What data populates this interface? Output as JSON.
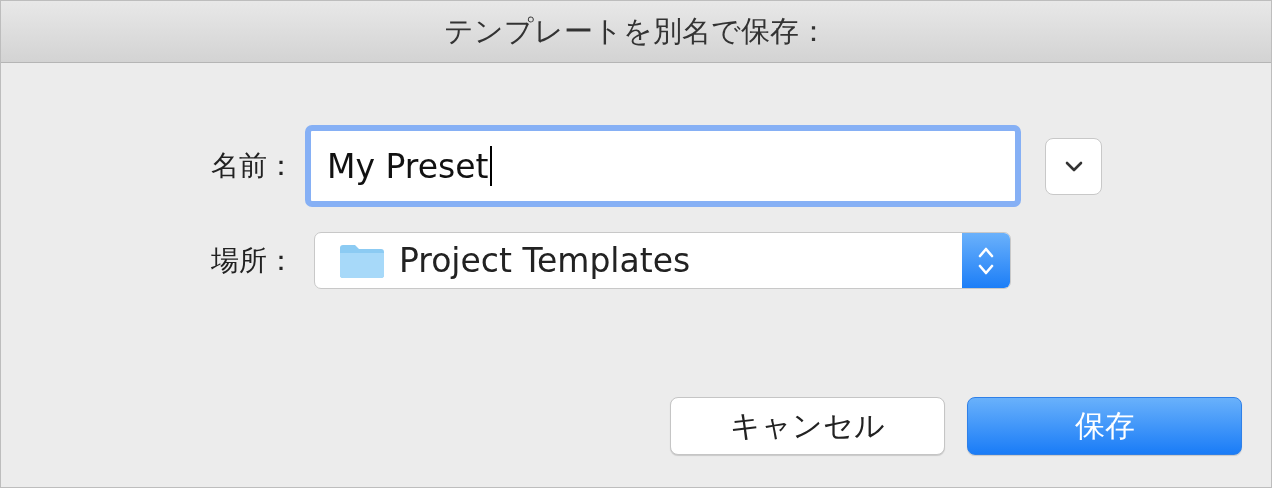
{
  "window": {
    "title": "テンプレートを別名で保存："
  },
  "name_field": {
    "label": "名前：",
    "value": "My Preset",
    "focused": true
  },
  "location": {
    "label": "場所：",
    "value": "Project Templates"
  },
  "buttons": [
    {
      "label": "キャンセル",
      "kind": "secondary"
    },
    {
      "label": "保存",
      "kind": "primary"
    }
  ]
}
